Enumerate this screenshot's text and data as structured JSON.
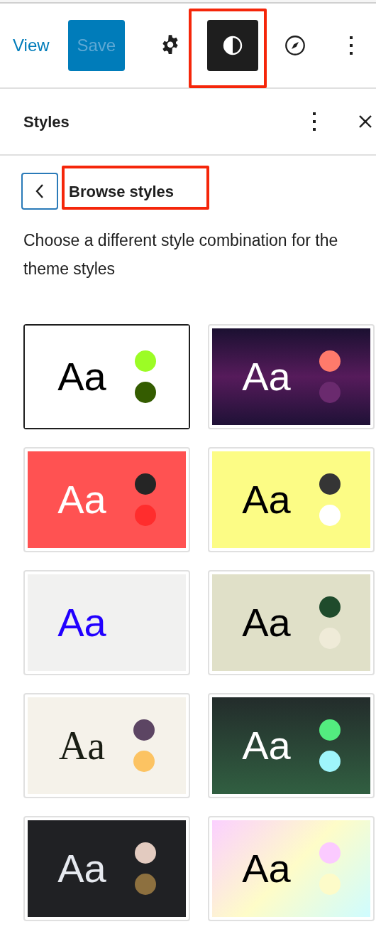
{
  "toolbar": {
    "view_link": "View",
    "save_button": {
      "label": "Save",
      "disabled": true
    },
    "tools": [
      {
        "kind": "settings",
        "selected": false,
        "highlighted": false
      },
      {
        "kind": "styles",
        "selected": true,
        "highlighted": true
      },
      {
        "kind": "navigation",
        "selected": false,
        "highlighted": false
      },
      {
        "kind": "more",
        "selected": false,
        "highlighted": false
      }
    ]
  },
  "panel": {
    "title": "Styles",
    "section_title": "Browse styles",
    "section_highlighted": true,
    "description": "Choose a different style combination for the theme styles"
  },
  "styles": [
    {
      "selected": true,
      "sample": {
        "text": "Aa",
        "serif": false,
        "color": "#000000"
      },
      "kind": "solid",
      "fill": [
        {
          "color": "#ffffff"
        }
      ],
      "dots": [
        {
          "color": "#9cfc25"
        },
        {
          "color": "#345c00"
        }
      ]
    },
    {
      "selected": false,
      "sample": {
        "text": "Aa",
        "serif": false,
        "color": "#ffffff"
      },
      "kind": "vertical",
      "fill": [
        {
          "color": "#1b1031"
        },
        {
          "color": "#561b5b"
        },
        {
          "color": "#1f1136"
        }
      ],
      "dots": [
        {
          "color": "#ff7a6b"
        },
        {
          "color": "#6a2a6e"
        }
      ]
    },
    {
      "selected": false,
      "sample": {
        "text": "Aa",
        "serif": false,
        "color": "#ffffff"
      },
      "kind": "solid",
      "fill": [
        {
          "color": "#ff5252"
        }
      ],
      "dots": [
        {
          "color": "#252525"
        },
        {
          "color": "#ff2d2d"
        }
      ]
    },
    {
      "selected": false,
      "sample": {
        "text": "Aa",
        "serif": false,
        "color": "#000000"
      },
      "kind": "solid",
      "fill": [
        {
          "color": "#fcfc85"
        }
      ],
      "dots": [
        {
          "color": "#353535"
        },
        {
          "color": "#ffffff"
        }
      ]
    },
    {
      "selected": false,
      "sample": {
        "text": "Aa",
        "serif": false,
        "color": "#2200ff"
      },
      "kind": "solid",
      "fill": [
        {
          "color": "#f1f1f0"
        }
      ]
    },
    {
      "selected": false,
      "sample": {
        "text": "Aa",
        "serif": false,
        "color": "#000000"
      },
      "kind": "solid",
      "fill": [
        {
          "color": "#e0e0c8"
        }
      ],
      "dots": [
        {
          "color": "#1f4b2c"
        },
        {
          "color": "#efebd8"
        }
      ]
    },
    {
      "selected": false,
      "sample": {
        "text": "Aa",
        "serif": true,
        "color": "#1a1e14"
      },
      "kind": "solid",
      "fill": [
        {
          "color": "#f5f2ea"
        }
      ],
      "dots": [
        {
          "color": "#5c4563"
        },
        {
          "color": "#fcc362"
        }
      ]
    },
    {
      "selected": false,
      "sample": {
        "text": "Aa",
        "serif": false,
        "color": "#ffffff"
      },
      "kind": "vertical",
      "fill": [
        {
          "color": "#232c2b"
        },
        {
          "color": "#315f41"
        }
      ],
      "dots": [
        {
          "color": "#53ec7f"
        },
        {
          "color": "#9ff5fb"
        }
      ]
    },
    {
      "selected": false,
      "sample": {
        "text": "Aa",
        "serif": false,
        "color": "#e6e9ef"
      },
      "kind": "solid",
      "fill": [
        {
          "color": "#202124"
        }
      ],
      "dots": [
        {
          "color": "#e3cbc0"
        },
        {
          "color": "#8d703f"
        }
      ]
    },
    {
      "selected": false,
      "sample": {
        "text": "Aa",
        "serif": false,
        "color": "#000000"
      },
      "kind": "diagonal",
      "fill": [
        {
          "color": "#fbd0ff"
        },
        {
          "color": "#fefcc8"
        },
        {
          "color": "#cffcff"
        }
      ],
      "dots": [
        {
          "color": "#fbcaff"
        },
        {
          "color": "#fdfbc9"
        }
      ]
    }
  ]
}
